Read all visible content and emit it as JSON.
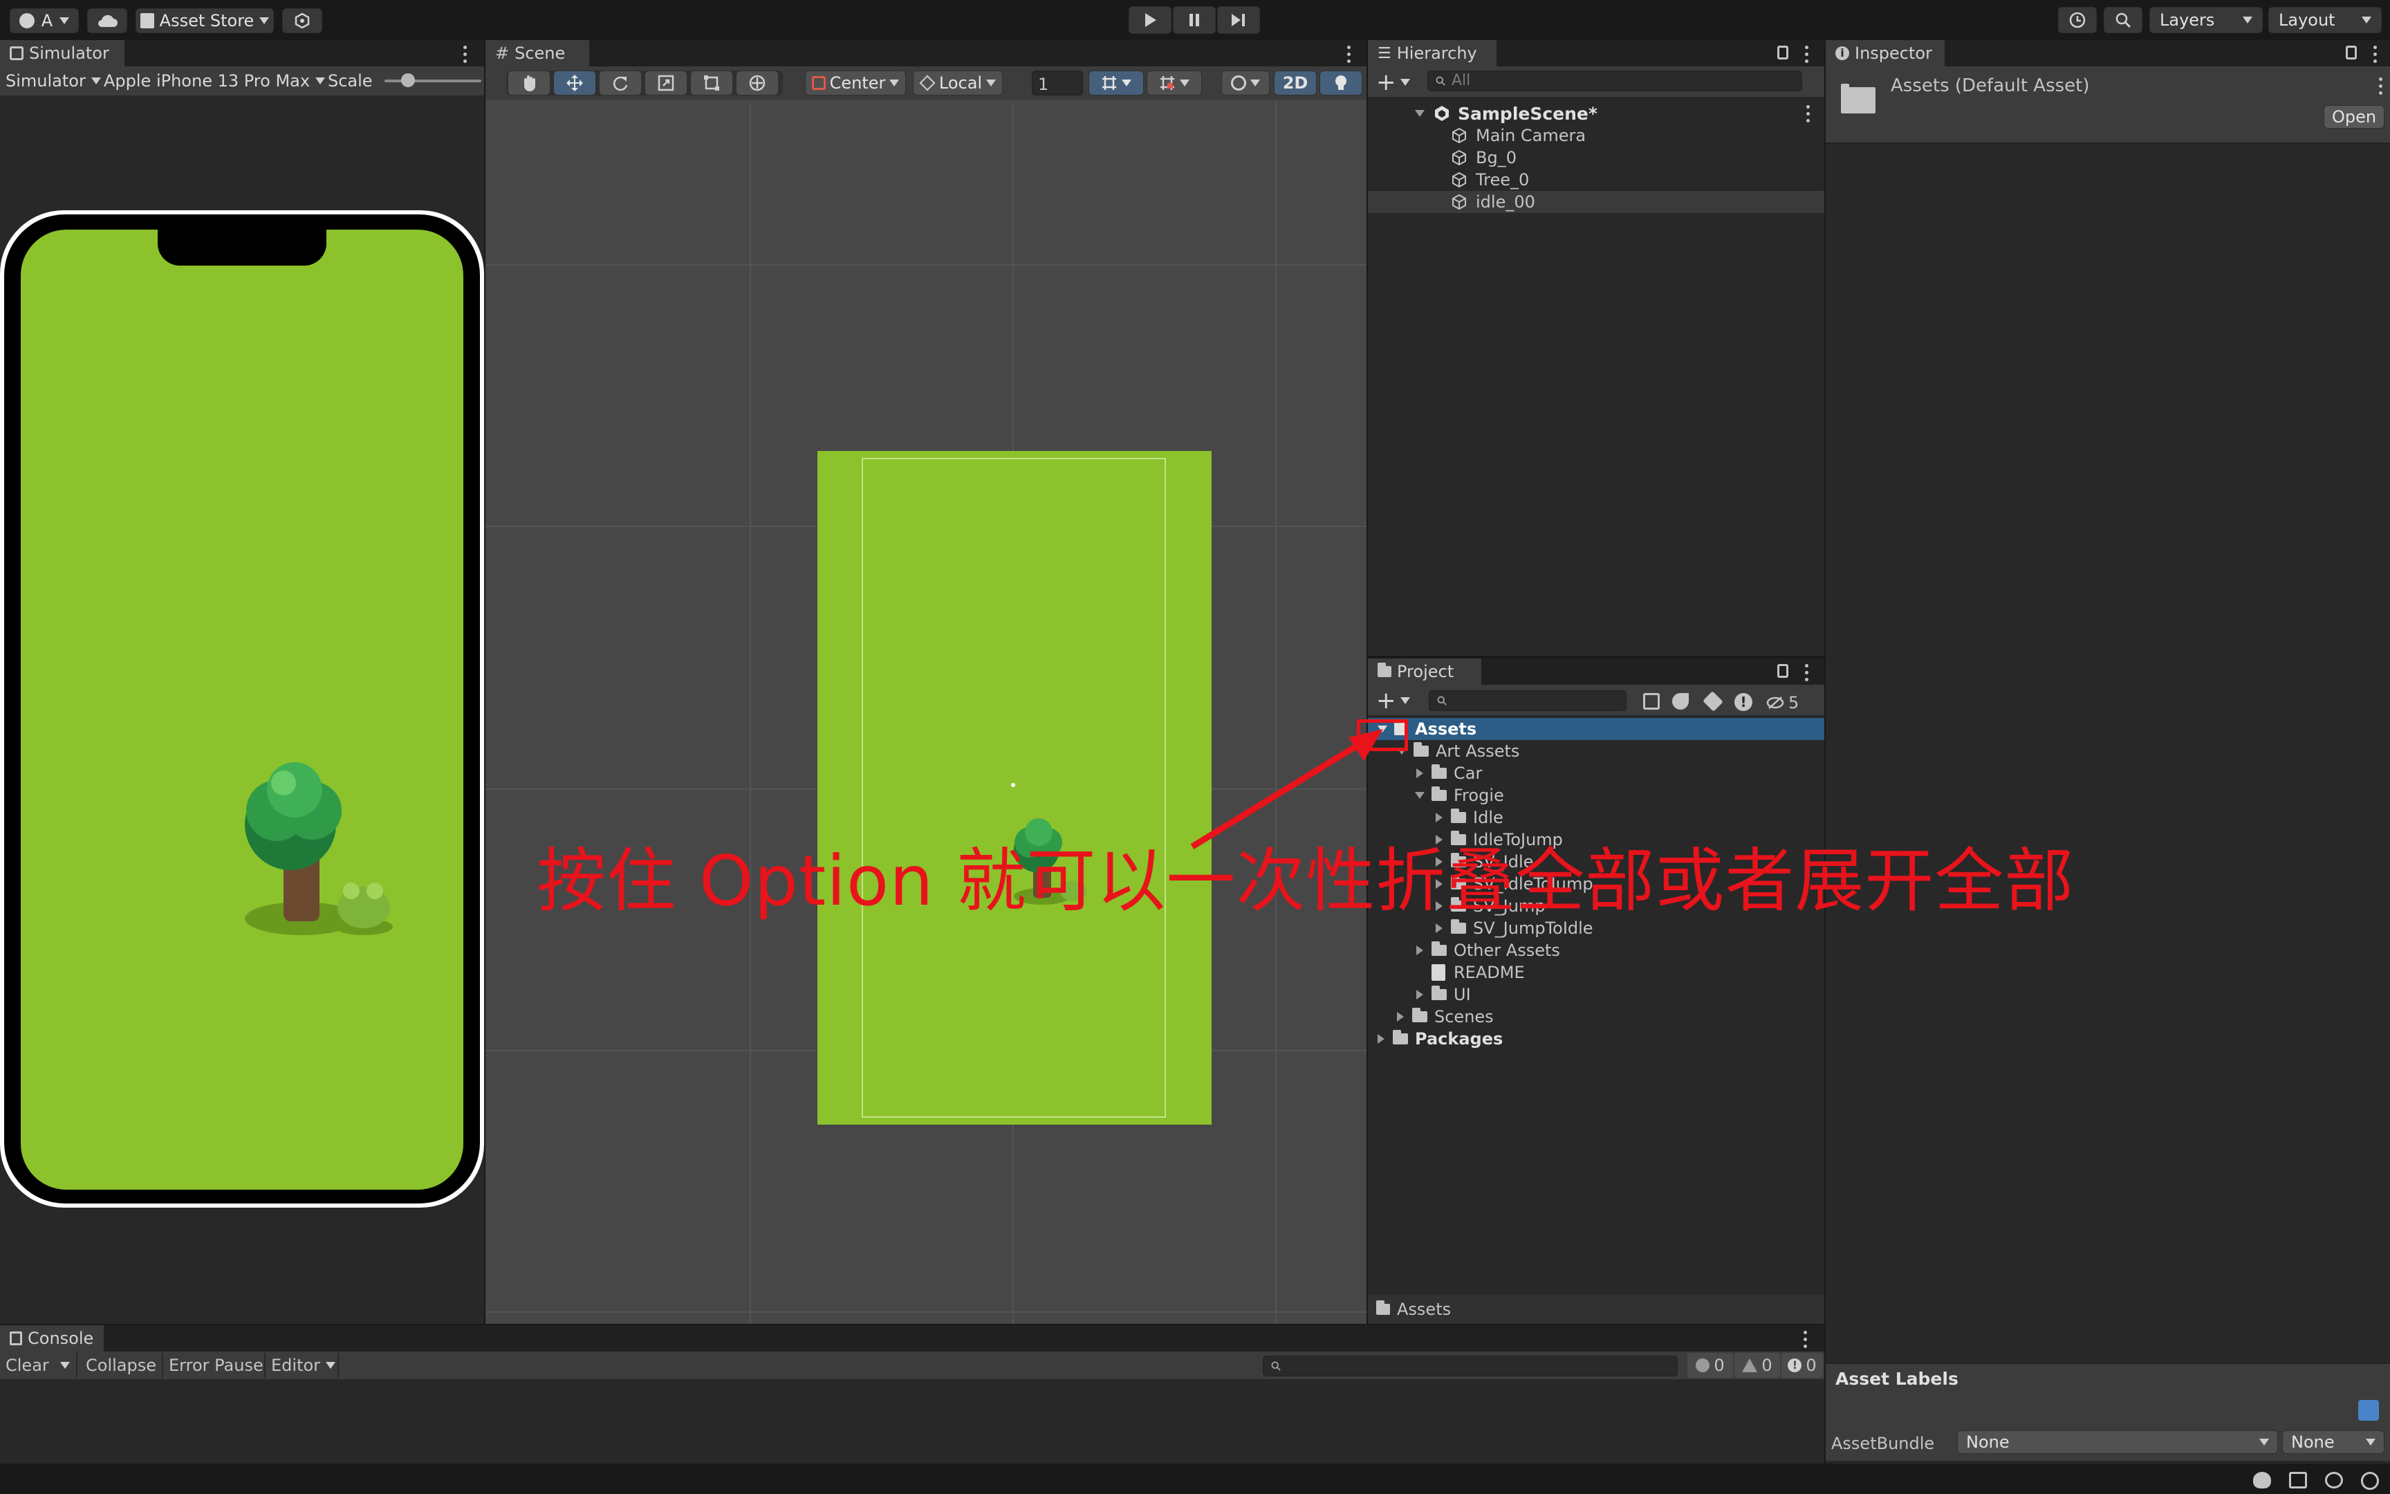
{
  "toolbar": {
    "account_label": "A",
    "asset_store_label": "Asset Store",
    "layers_label": "Layers",
    "layout_label": "Layout"
  },
  "simulator": {
    "tab_label": "Simulator",
    "mode_label": "Simulator",
    "device_label": "Apple iPhone 13 Pro Max",
    "scale_label": "Scale"
  },
  "scene": {
    "tab_label": "Scene",
    "pivot_label": "Center",
    "space_label": "Local",
    "grid_value": "1",
    "mode_2d_label": "2D"
  },
  "hierarchy": {
    "tab_label": "Hierarchy",
    "search_placeholder": "All",
    "scene_name": "SampleScene*",
    "items": [
      {
        "label": "Main Camera"
      },
      {
        "label": "Bg_0"
      },
      {
        "label": "Tree_0"
      },
      {
        "label": "idle_00"
      }
    ]
  },
  "project": {
    "tab_label": "Project",
    "hidden_count": "5",
    "footer_path": "Assets",
    "tree": [
      {
        "label": "Assets"
      },
      {
        "label": "Art Assets"
      },
      {
        "label": "Car"
      },
      {
        "label": "Frogie"
      },
      {
        "label": "Idle"
      },
      {
        "label": "IdleToJump"
      },
      {
        "label": "SV_Idle"
      },
      {
        "label": "SV_IdleToJump"
      },
      {
        "label": "SV_Jump"
      },
      {
        "label": "SV_JumpToIdle"
      },
      {
        "label": "Other Assets"
      },
      {
        "label": "README"
      },
      {
        "label": "UI"
      },
      {
        "label": "Scenes"
      },
      {
        "label": "Packages"
      }
    ]
  },
  "inspector": {
    "tab_label": "Inspector",
    "asset_title": "Assets (Default Asset)",
    "open_label": "Open",
    "asset_labels_heading": "Asset Labels",
    "asset_bundle_label": "AssetBundle",
    "bundle_value": "None",
    "variant_value": "None"
  },
  "console": {
    "tab_label": "Console",
    "clear_label": "Clear",
    "collapse_label": "Collapse",
    "error_pause_label": "Error Pause",
    "editor_label": "Editor",
    "log_count": "0",
    "warning_count": "0",
    "error_count": "0"
  },
  "annotation": {
    "text": "按住 Option 就可以一次性折叠全部或者展开全部",
    "color": "#e8131b"
  },
  "colors": {
    "grass": "#8cc22b",
    "selection": "#2c5d87",
    "accent_blue": "#46607c"
  }
}
